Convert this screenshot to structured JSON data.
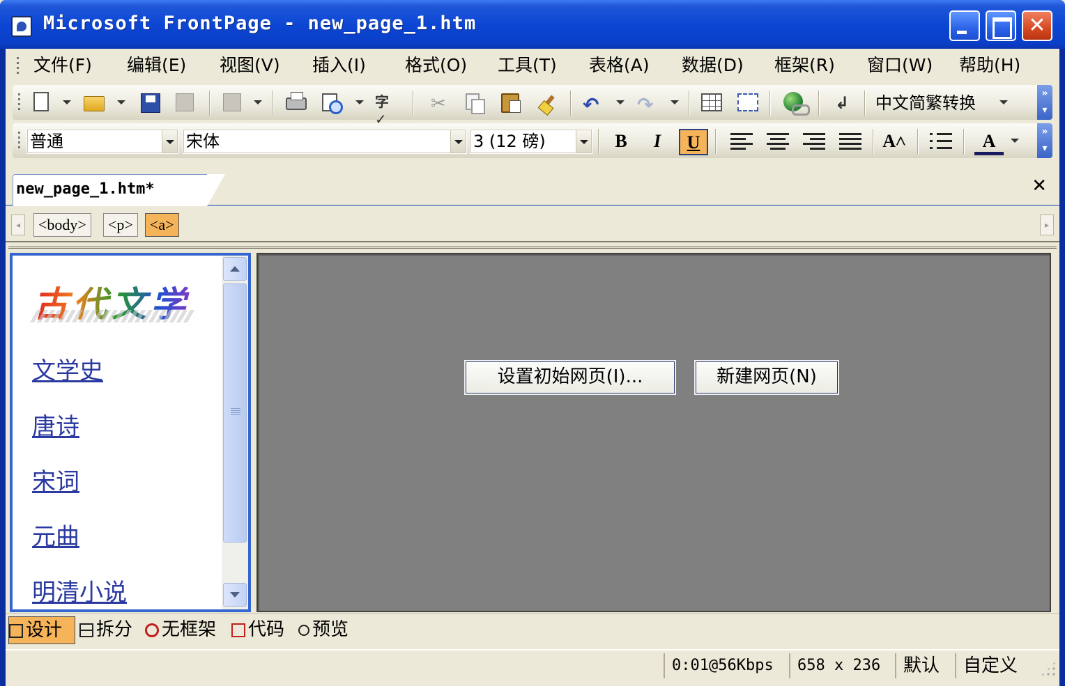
{
  "window": {
    "title": "Microsoft FrontPage - new_page_1.htm",
    "colors": {
      "titlebar": "#0a46d4",
      "accent": "#f5b35a",
      "frame_border": "#3566d0",
      "link": "#2a3aa0"
    }
  },
  "menu": {
    "items": [
      "文件(F)",
      "编辑(E)",
      "视图(V)",
      "插入(I)",
      "格式(O)",
      "工具(T)",
      "表格(A)",
      "数据(D)",
      "框架(R)",
      "窗口(W)",
      "帮助(H)"
    ]
  },
  "standard_toolbar": {
    "icons": [
      "new-page-icon",
      "open-folder-icon",
      "save-icon",
      "publish-icon",
      "insert-web-component-icon",
      "print-icon",
      "print-preview-icon",
      "spelling-icon",
      "cut-icon",
      "copy-icon",
      "paste-icon",
      "format-painter-icon",
      "undo-icon",
      "redo-icon",
      "insert-table-icon",
      "insert-layer-icon",
      "web-component-icon",
      "show-code-icon"
    ],
    "convert_label": "中文简繁转换"
  },
  "format_toolbar": {
    "style_value": "普通",
    "font_value": "宋体",
    "size_value": "3 (12 磅)",
    "bold": "B",
    "italic": "I",
    "underline": "U",
    "underline_active": true,
    "font_color_label": "A"
  },
  "document": {
    "tab_label": "new_page_1.htm*",
    "tags": [
      "<body>",
      "<p>",
      "<a>"
    ],
    "active_tag": "<a>"
  },
  "left_frame": {
    "logo_text": "古代文学",
    "links": [
      "文学史",
      "唐诗",
      "宋词",
      "元曲",
      "明清小说"
    ]
  },
  "right_frame": {
    "set_initial_page_button": "设置初始网页(I)...",
    "new_page_button": "新建网页(N)"
  },
  "view_tabs": {
    "items": [
      "设计",
      "拆分",
      "无框架",
      "代码",
      "预览"
    ],
    "active": "设计"
  },
  "status": {
    "download_time": "0:01@56Kbps",
    "page_size": "658 x 236",
    "mode1": "默认",
    "mode2": "自定义"
  }
}
